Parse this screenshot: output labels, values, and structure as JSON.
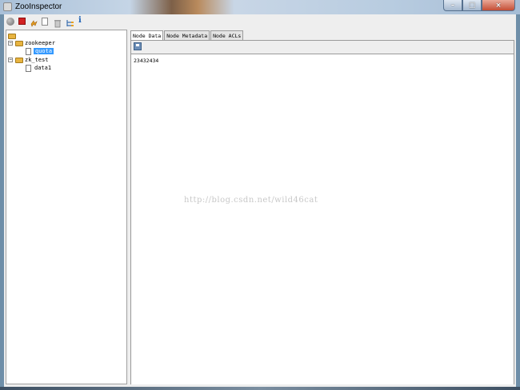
{
  "window": {
    "title": "ZooInspector"
  },
  "toolbar": {
    "icons": [
      "connect-icon",
      "disconnect-icon",
      "refresh-icon",
      "add-node-icon",
      "delete-node-icon",
      "change-viewers-icon",
      "about-icon"
    ],
    "about_glyph": "i"
  },
  "tree": {
    "nodes": [
      {
        "label": "zookeeper",
        "expanded": true
      },
      {
        "label": "quota",
        "selected": true
      },
      {
        "label": "zk_test",
        "expanded": true
      },
      {
        "label": "data1"
      }
    ],
    "expanded_glyph": "−"
  },
  "tabs": [
    {
      "label": "Node Data",
      "active": true
    },
    {
      "label": "Node Metadata"
    },
    {
      "label": "Node ACLs"
    }
  ],
  "node_data": {
    "value": "23432434"
  },
  "watermark": "http://blog.csdn.net/wild46cat",
  "window_buttons": {
    "minimize": "–",
    "maximize": "□",
    "close": "×"
  }
}
